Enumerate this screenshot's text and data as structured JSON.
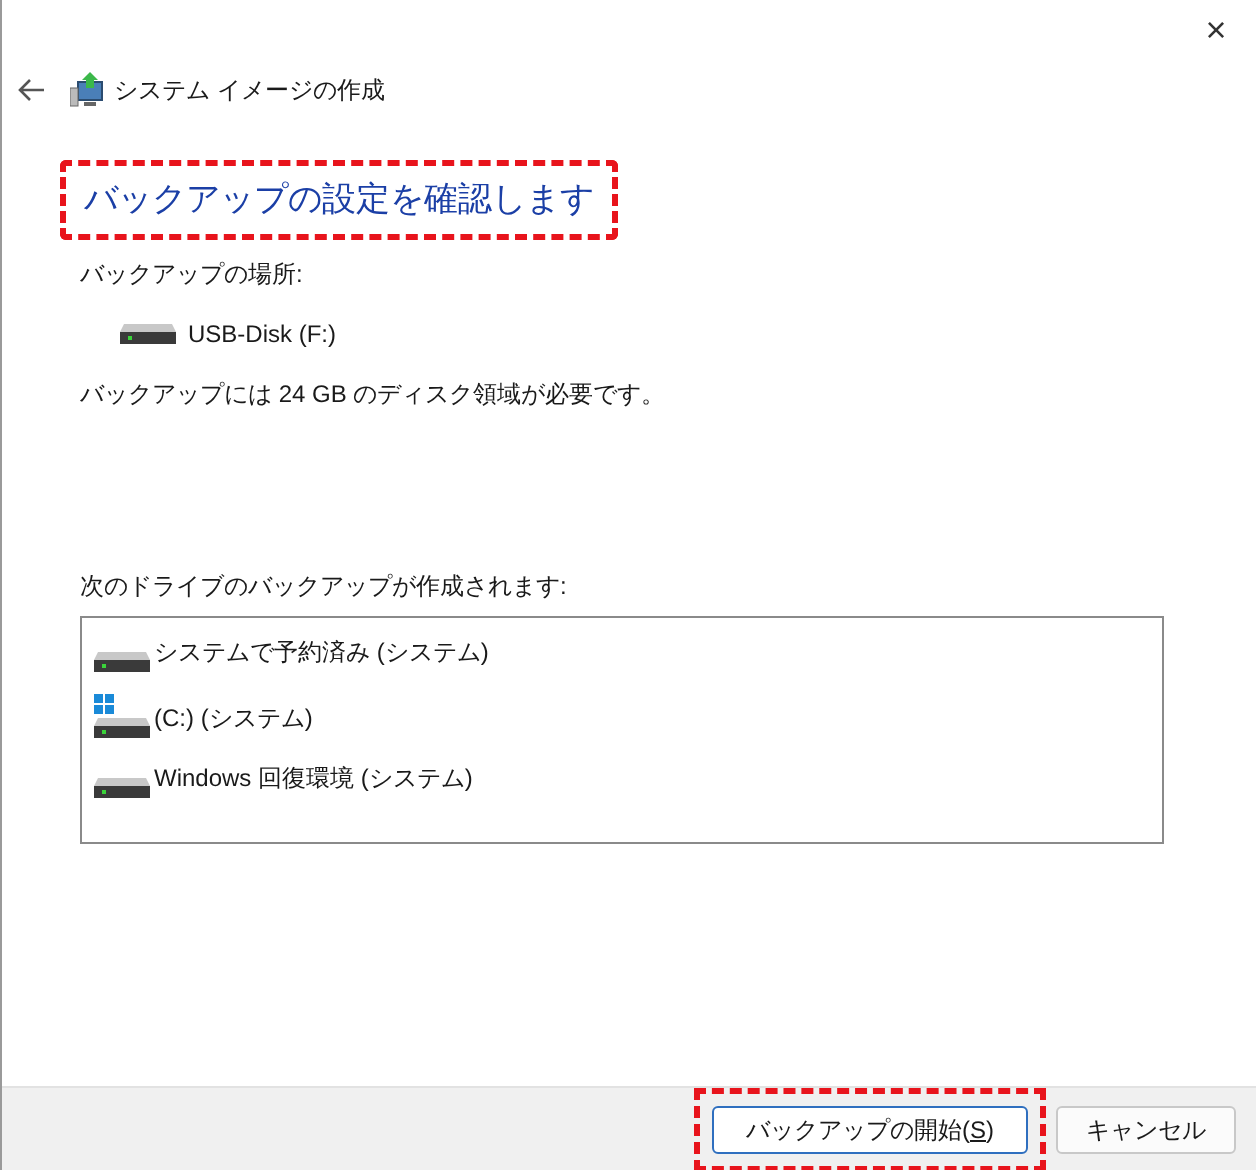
{
  "window": {
    "close": "×",
    "nav_title": "システム イメージの作成"
  },
  "heading": "バックアップの設定を確認します",
  "location_label": "バックアップの場所:",
  "location_drive": "USB-Disk (F:)",
  "space_note": "バックアップには 24 GB のディスク領域が必要です。",
  "drives_label": "次のドライブのバックアップが作成されます:",
  "drives": [
    {
      "name": "システムで予約済み (システム)",
      "windows_logo": false
    },
    {
      "name": "(C:) (システム)",
      "windows_logo": true
    },
    {
      "name": "Windows 回復環境 (システム)",
      "windows_logo": false
    }
  ],
  "buttons": [
    {
      "label_before": "バックアップの開始(",
      "access_key": "S",
      "label_after": ")",
      "primary": true,
      "highlighted": true
    },
    {
      "label_before": "キャンセル",
      "primary": false,
      "highlighted": false
    }
  ],
  "heading_highlighted": true
}
